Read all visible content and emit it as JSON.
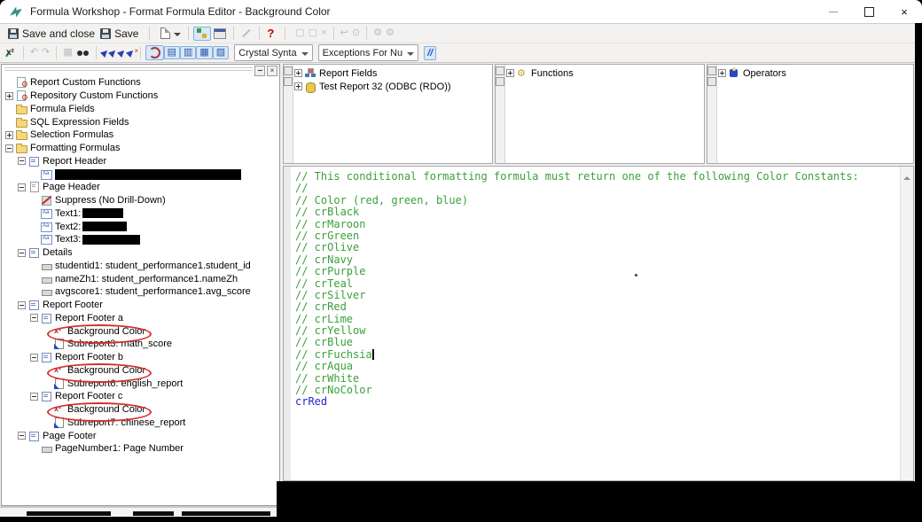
{
  "window": {
    "title": "Formula Workshop - Format Formula Editor - Background Color"
  },
  "toolbar_main": {
    "save_and_close_label": "Save and close",
    "save_label": "Save",
    "help_label": "?"
  },
  "toolbar_formula": {
    "syntax_value": "Crystal Synta",
    "exceptions_value": "Exceptions For Nu",
    "comment_label": "//"
  },
  "glyphs": {
    "close": "×",
    "delete": "×",
    "undo": "↶",
    "redo": "↷",
    "gear": "⚙",
    "screen": "▦",
    "doc": "▢",
    "hook": "↩",
    "circle": "⊙",
    "dart": "▶",
    "bookmark1": "▤",
    "bookmark2": "▥",
    "bookmark3": "▦",
    "bookmark4": "▧"
  },
  "explorer": {
    "items": [
      {
        "label": "Report Custom Functions",
        "indent": 0,
        "exp": null,
        "icon": "i-gearpage"
      },
      {
        "label": "Repository Custom Functions",
        "indent": 0,
        "exp": "plus",
        "icon": "i-gearpage"
      },
      {
        "label": "Formula Fields",
        "indent": 0,
        "exp": null,
        "icon": "i-folder"
      },
      {
        "label": "SQL Expression Fields",
        "indent": 0,
        "exp": null,
        "icon": "i-folder"
      },
      {
        "label": "Selection Formulas",
        "indent": 0,
        "exp": "plus",
        "icon": "i-folder"
      },
      {
        "label": "Formatting Formulas",
        "indent": 0,
        "exp": "minus",
        "icon": "i-folder"
      },
      {
        "label": "Report Header",
        "indent": 1,
        "exp": "minus",
        "icon": "i-section"
      },
      {
        "label": "",
        "indent": 2,
        "exp": null,
        "icon": "i-text",
        "redact_label": 210
      },
      {
        "label": "Page Header",
        "indent": 1,
        "exp": "minus",
        "icon": "i-page"
      },
      {
        "label": "Suppress (No Drill-Down)",
        "indent": 2,
        "exp": null,
        "icon": "i-suppress"
      },
      {
        "label": "Text1:",
        "indent": 2,
        "exp": null,
        "icon": "i-text",
        "value_redact": 46
      },
      {
        "label": "Text2:",
        "indent": 2,
        "exp": null,
        "icon": "i-text",
        "value_redact": 50
      },
      {
        "label": "Text3:",
        "indent": 2,
        "exp": null,
        "icon": "i-text",
        "value_redact": 65
      },
      {
        "label": "Details",
        "indent": 1,
        "exp": "minus",
        "icon": "i-section"
      },
      {
        "label": "studentid1: student_performance1.student_id",
        "indent": 2,
        "exp": null,
        "icon": "i-field"
      },
      {
        "label": "nameZh1: student_performance1.nameZh",
        "indent": 2,
        "exp": null,
        "icon": "i-field"
      },
      {
        "label": "avgscore1: student_performance1.avg_score",
        "indent": 2,
        "exp": null,
        "icon": "i-field"
      },
      {
        "label": "Report Footer",
        "indent": 1,
        "exp": "minus",
        "icon": "i-section"
      },
      {
        "label": "Report Footer a",
        "indent": 2,
        "exp": "minus",
        "icon": "i-section"
      },
      {
        "label": "Background Color",
        "indent": 3,
        "exp": null,
        "icon": "i-formula",
        "circled": true
      },
      {
        "label": "Subreport3: math_score",
        "indent": 3,
        "exp": null,
        "icon": "i-subreport"
      },
      {
        "label": "Report Footer b",
        "indent": 2,
        "exp": "minus",
        "icon": "i-section"
      },
      {
        "label": "Background Color",
        "indent": 3,
        "exp": null,
        "icon": "i-formula",
        "circled": true
      },
      {
        "label": "Subreport6: english_report",
        "indent": 3,
        "exp": null,
        "icon": "i-subreport"
      },
      {
        "label": "Report Footer c",
        "indent": 2,
        "exp": "minus",
        "icon": "i-section"
      },
      {
        "label": "Background Color",
        "indent": 3,
        "exp": null,
        "icon": "i-formula",
        "circled": true
      },
      {
        "label": "Subreport7: chinese_report",
        "indent": 3,
        "exp": null,
        "icon": "i-subreport"
      },
      {
        "label": "Page Footer",
        "indent": 1,
        "exp": "minus",
        "icon": "i-section"
      },
      {
        "label": "PageNumber1: Page Number",
        "indent": 2,
        "exp": null,
        "icon": "i-field"
      }
    ]
  },
  "panels": {
    "report_fields": {
      "rows": [
        {
          "label": "Report Fields",
          "exp": "plus",
          "icon": "i-repfields"
        },
        {
          "label": "Test Report 32 (ODBC (RDO))",
          "exp": "plus",
          "icon": "i-database"
        }
      ]
    },
    "functions": {
      "rows": [
        {
          "label": "Functions",
          "exp": "plus",
          "icon": "i-functions"
        }
      ]
    },
    "operators": {
      "rows": [
        {
          "label": "Operators",
          "exp": "plus",
          "icon": "i-operators"
        }
      ]
    }
  },
  "editor": {
    "comment_color": "#3ba03b",
    "keyword_color": "#2424cc",
    "caret_after_line": 15,
    "lines": [
      {
        "text": "// This conditional formatting formula must return one of the following Color Constants:",
        "kind": "comment"
      },
      {
        "text": "//",
        "kind": "comment"
      },
      {
        "text": "// Color (red, green, blue)",
        "kind": "comment"
      },
      {
        "text": "// crBlack",
        "kind": "comment"
      },
      {
        "text": "// crMaroon",
        "kind": "comment"
      },
      {
        "text": "// crGreen",
        "kind": "comment"
      },
      {
        "text": "// crOlive",
        "kind": "comment"
      },
      {
        "text": "// crNavy",
        "kind": "comment"
      },
      {
        "text": "// crPurple",
        "kind": "comment"
      },
      {
        "text": "// crTeal",
        "kind": "comment"
      },
      {
        "text": "// crSilver",
        "kind": "comment"
      },
      {
        "text": "// crRed",
        "kind": "comment"
      },
      {
        "text": "// crLime",
        "kind": "comment"
      },
      {
        "text": "// crYellow",
        "kind": "comment"
      },
      {
        "text": "// crBlue",
        "kind": "comment"
      },
      {
        "text": "// crFuchsia",
        "kind": "comment"
      },
      {
        "text": "// crAqua",
        "kind": "comment"
      },
      {
        "text": "// crWhite",
        "kind": "comment"
      },
      {
        "text": "// crNoColor",
        "kind": "comment"
      },
      {
        "text": "crRed",
        "kind": "code"
      }
    ]
  }
}
